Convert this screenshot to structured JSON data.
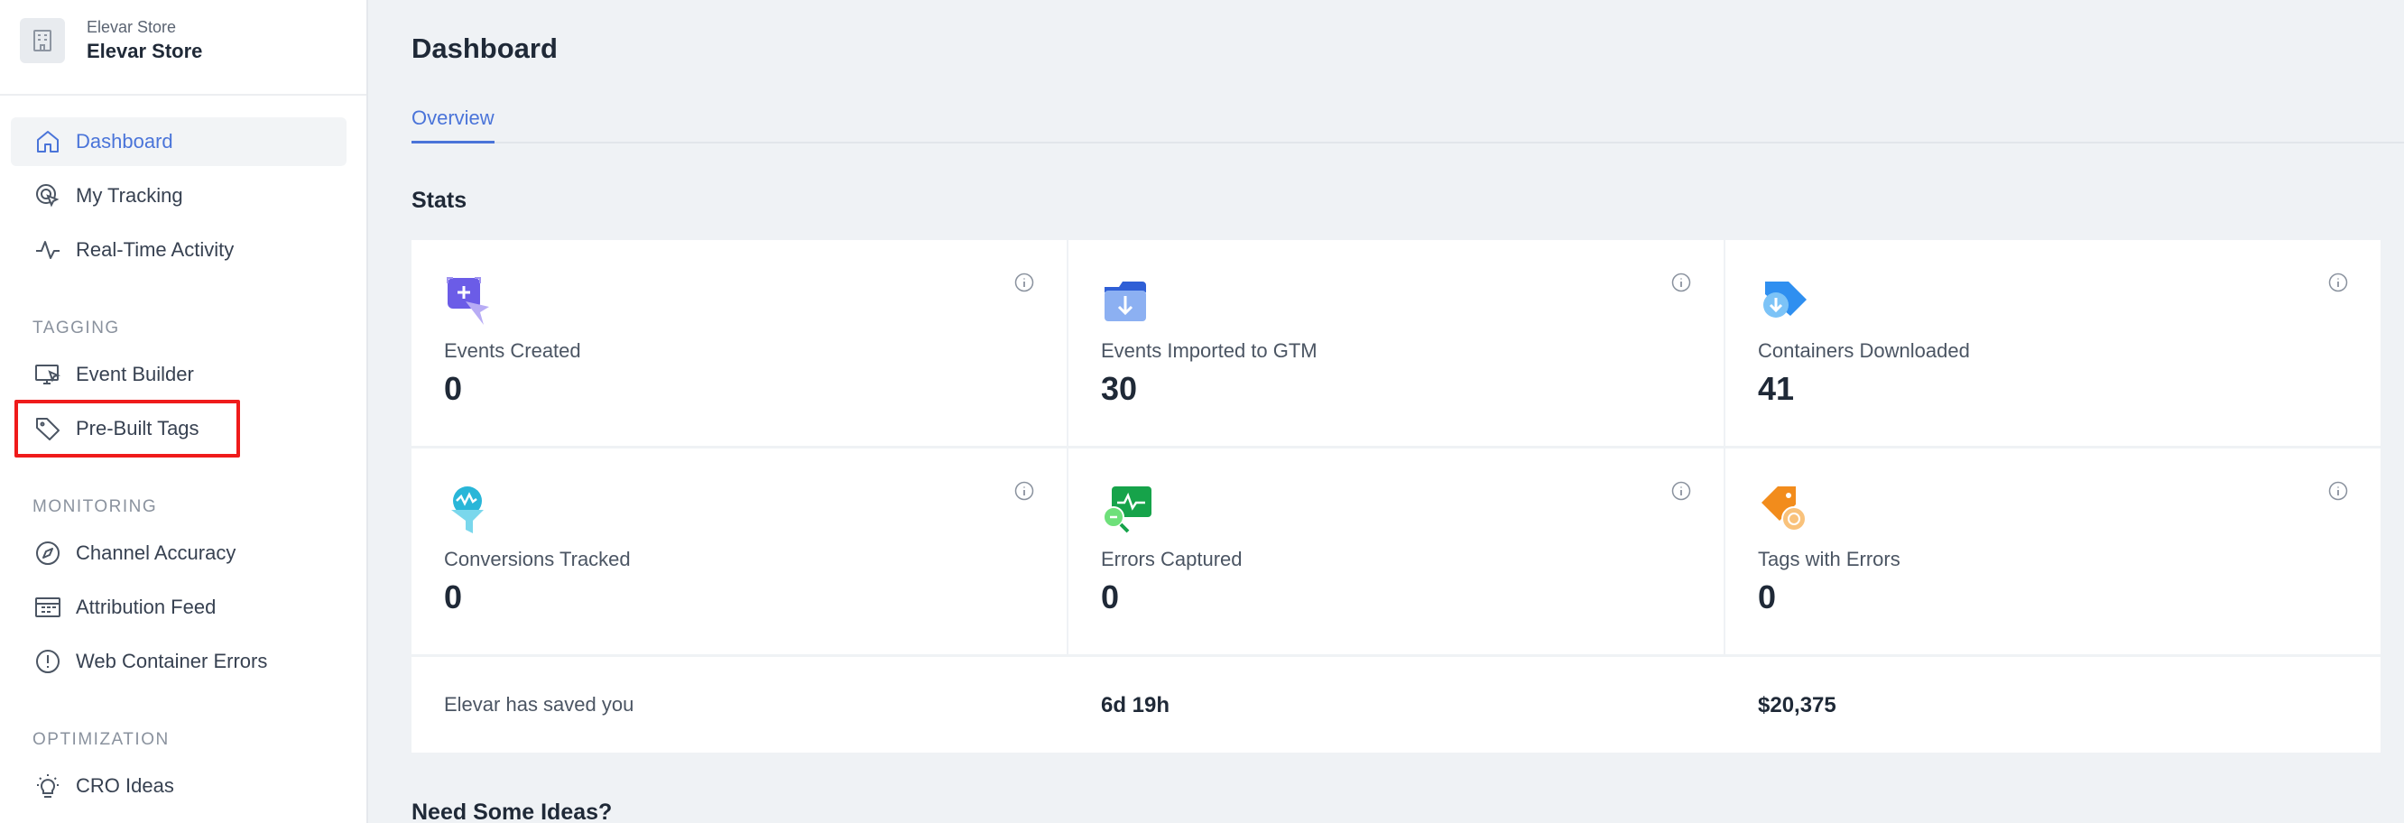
{
  "sidebar": {
    "store_sub": "Elevar Store",
    "store_name": "Elevar Store",
    "nav": {
      "dashboard": "Dashboard",
      "my_tracking": "My Tracking",
      "realtime": "Real-Time Activity",
      "event_builder": "Event Builder",
      "prebuilt_tags": "Pre-Built Tags",
      "channel_accuracy": "Channel Accuracy",
      "attribution_feed": "Attribution Feed",
      "web_container_errors": "Web Container Errors",
      "cro_ideas": "CRO Ideas"
    },
    "sections": {
      "tagging": "TAGGING",
      "monitoring": "MONITORING",
      "optimization": "OPTIMIZATION"
    }
  },
  "main": {
    "title": "Dashboard",
    "tab_overview": "Overview",
    "stats_title": "Stats",
    "stats": [
      {
        "label": "Events Created",
        "value": "0",
        "icon": "events-created-icon"
      },
      {
        "label": "Events Imported to GTM",
        "value": "30",
        "icon": "gtm-import-icon"
      },
      {
        "label": "Containers Downloaded",
        "value": "41",
        "icon": "container-download-icon"
      },
      {
        "label": "Conversions Tracked",
        "value": "0",
        "icon": "conversion-funnel-icon"
      },
      {
        "label": "Errors Captured",
        "value": "0",
        "icon": "errors-monitor-icon"
      },
      {
        "label": "Tags with Errors",
        "value": "0",
        "icon": "tag-error-icon"
      }
    ],
    "saved": {
      "label": "Elevar has saved you",
      "time": "6d 19h",
      "money": "$20,375"
    },
    "ideas_title": "Need Some Ideas?"
  },
  "colors": {
    "accent": "#4a74d9",
    "highlight": "#ef1b1b",
    "background": "#eff2f5"
  }
}
